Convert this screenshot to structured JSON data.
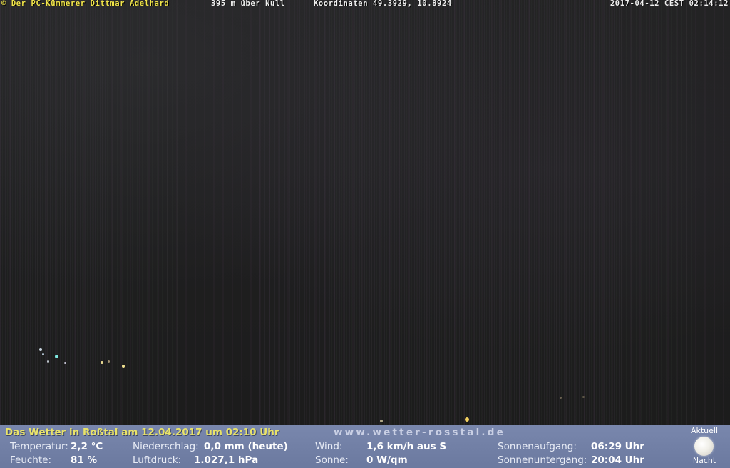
{
  "overlay": {
    "credit": "© Der PC-Kümmerer Dittmar Adelhard",
    "elevation": "395 m über Null",
    "coordinates": "Koordinaten 49.3929, 10.8924",
    "timestamp": "2017-04-12 CEST 02:14:12"
  },
  "footer": {
    "title": "Das Wetter in Roßtal am 12.04.2017 um 02:10 Uhr",
    "url": "www.wetter-rosstal.de",
    "temperature_label": "Temperatur:",
    "temperature_value": "2,2 °C",
    "humidity_label": "Feuchte:",
    "humidity_value": "81 %",
    "precip_label": "Niederschlag:",
    "precip_value": "0,0 mm (heute)",
    "pressure_label": "Luftdruck:",
    "pressure_value": "1.027,1 hPa",
    "wind_label": "Wind:",
    "wind_value": "1,6 km/h aus S",
    "sun_label": "Sonne:",
    "sun_value": "0 W/qm",
    "sunrise_label": "Sonnenaufgang:",
    "sunrise_value": "06:29 Uhr",
    "sunset_label": "Sonnenuntergang:",
    "sunset_value": "20:04 Uhr",
    "moon_top": "Aktuell",
    "moon_bottom": "Nacht",
    "moon_icon": "full-moon-icon"
  },
  "colors": {
    "overlay_text": "#f2e64a",
    "footer_bg": "#7987ad",
    "footer_title": "#e9e36a"
  }
}
